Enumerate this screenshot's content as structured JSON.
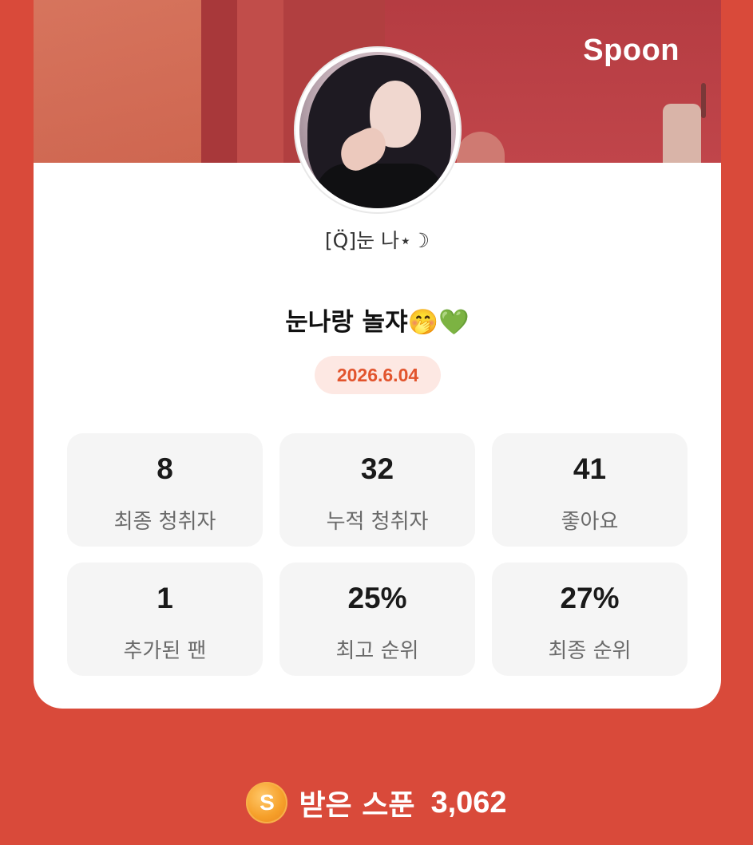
{
  "brand": {
    "name": "Spoon"
  },
  "profile": {
    "nickname": "[Q̈]눈 나⋆☽",
    "title": "눈나랑 놀쟈🤭💚",
    "date": "2026.6.04"
  },
  "stats": [
    {
      "value": "8",
      "label": "최종 청취자"
    },
    {
      "value": "32",
      "label": "누적 청취자"
    },
    {
      "value": "41",
      "label": "좋아요"
    },
    {
      "value": "1",
      "label": "추가된 팬"
    },
    {
      "value": "25%",
      "label": "최고 순위"
    },
    {
      "value": "27%",
      "label": "최종 순위"
    }
  ],
  "footer": {
    "coin_symbol": "S",
    "label": "받은 스푼",
    "value": "3,062"
  },
  "colors": {
    "background": "#d94a3a",
    "accent": "#e2542d",
    "badge_bg": "#fde8e3"
  },
  "icons": [
    "avatar-image",
    "spoon-coin-icon"
  ]
}
